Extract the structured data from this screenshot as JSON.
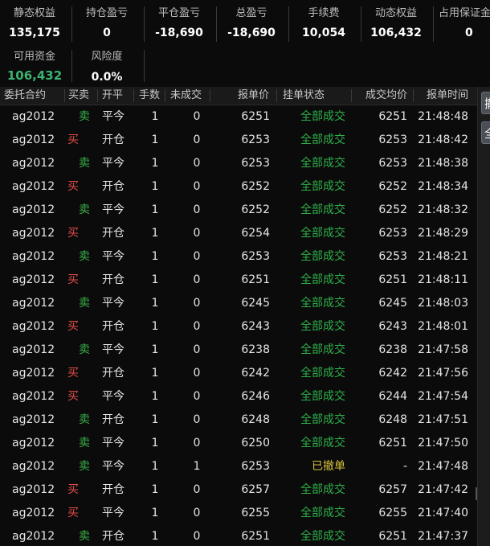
{
  "summary": {
    "static_equity": {
      "label": "静态权益",
      "value": "135,175"
    },
    "position_pnl": {
      "label": "持仓盈亏",
      "value": "0"
    },
    "close_pnl": {
      "label": "平仓盈亏",
      "value": "-18,690"
    },
    "total_pnl": {
      "label": "总盈亏",
      "value": "-18,690"
    },
    "fee": {
      "label": "手续费",
      "value": "10,054"
    },
    "dynamic_equity": {
      "label": "动态权益",
      "value": "106,432"
    },
    "margin_used": {
      "label": "占用保证金",
      "value": "0"
    },
    "available": {
      "label": "可用资金",
      "value": "106,432"
    },
    "risk": {
      "label": "风险度",
      "value": "0.0%"
    }
  },
  "table": {
    "headers": {
      "contract": "委托合约",
      "side": "买卖",
      "openclose": "开平",
      "qty": "手数",
      "unfilled": "未成交",
      "price": "报单价",
      "status": "挂单状态",
      "avg": "成交均价",
      "time": "报单时间"
    },
    "rows": [
      {
        "contract": "ag2012",
        "side": "卖",
        "openclose": "平今",
        "qty": "1",
        "unfilled": "0",
        "price": "6251",
        "status": "全部成交",
        "avg": "6251",
        "time": "21:48:48"
      },
      {
        "contract": "ag2012",
        "side": "买",
        "openclose": "开仓",
        "qty": "1",
        "unfilled": "0",
        "price": "6253",
        "status": "全部成交",
        "avg": "6253",
        "time": "21:48:42"
      },
      {
        "contract": "ag2012",
        "side": "卖",
        "openclose": "平今",
        "qty": "1",
        "unfilled": "0",
        "price": "6253",
        "status": "全部成交",
        "avg": "6253",
        "time": "21:48:38"
      },
      {
        "contract": "ag2012",
        "side": "买",
        "openclose": "开仓",
        "qty": "1",
        "unfilled": "0",
        "price": "6252",
        "status": "全部成交",
        "avg": "6252",
        "time": "21:48:34"
      },
      {
        "contract": "ag2012",
        "side": "卖",
        "openclose": "平今",
        "qty": "1",
        "unfilled": "0",
        "price": "6252",
        "status": "全部成交",
        "avg": "6252",
        "time": "21:48:32"
      },
      {
        "contract": "ag2012",
        "side": "买",
        "openclose": "开仓",
        "qty": "1",
        "unfilled": "0",
        "price": "6254",
        "status": "全部成交",
        "avg": "6253",
        "time": "21:48:29"
      },
      {
        "contract": "ag2012",
        "side": "卖",
        "openclose": "平今",
        "qty": "1",
        "unfilled": "0",
        "price": "6253",
        "status": "全部成交",
        "avg": "6253",
        "time": "21:48:21"
      },
      {
        "contract": "ag2012",
        "side": "买",
        "openclose": "开仓",
        "qty": "1",
        "unfilled": "0",
        "price": "6251",
        "status": "全部成交",
        "avg": "6251",
        "time": "21:48:11"
      },
      {
        "contract": "ag2012",
        "side": "卖",
        "openclose": "平今",
        "qty": "1",
        "unfilled": "0",
        "price": "6245",
        "status": "全部成交",
        "avg": "6245",
        "time": "21:48:03"
      },
      {
        "contract": "ag2012",
        "side": "买",
        "openclose": "开仓",
        "qty": "1",
        "unfilled": "0",
        "price": "6243",
        "status": "全部成交",
        "avg": "6243",
        "time": "21:48:01"
      },
      {
        "contract": "ag2012",
        "side": "卖",
        "openclose": "平今",
        "qty": "1",
        "unfilled": "0",
        "price": "6238",
        "status": "全部成交",
        "avg": "6238",
        "time": "21:47:58"
      },
      {
        "contract": "ag2012",
        "side": "买",
        "openclose": "开仓",
        "qty": "1",
        "unfilled": "0",
        "price": "6242",
        "status": "全部成交",
        "avg": "6242",
        "time": "21:47:56"
      },
      {
        "contract": "ag2012",
        "side": "买",
        "openclose": "平今",
        "qty": "1",
        "unfilled": "0",
        "price": "6246",
        "status": "全部成交",
        "avg": "6244",
        "time": "21:47:54"
      },
      {
        "contract": "ag2012",
        "side": "卖",
        "openclose": "开仓",
        "qty": "1",
        "unfilled": "0",
        "price": "6248",
        "status": "全部成交",
        "avg": "6248",
        "time": "21:47:51"
      },
      {
        "contract": "ag2012",
        "side": "卖",
        "openclose": "平今",
        "qty": "1",
        "unfilled": "0",
        "price": "6250",
        "status": "全部成交",
        "avg": "6251",
        "time": "21:47:50"
      },
      {
        "contract": "ag2012",
        "side": "卖",
        "openclose": "平今",
        "qty": "1",
        "unfilled": "1",
        "price": "6253",
        "status": "已撤单",
        "avg": "-",
        "time": "21:47:48"
      },
      {
        "contract": "ag2012",
        "side": "买",
        "openclose": "开仓",
        "qty": "1",
        "unfilled": "0",
        "price": "6257",
        "status": "全部成交",
        "avg": "6257",
        "time": "21:47:42"
      },
      {
        "contract": "ag2012",
        "side": "买",
        "openclose": "平今",
        "qty": "1",
        "unfilled": "0",
        "price": "6255",
        "status": "全部成交",
        "avg": "6255",
        "time": "21:47:40"
      },
      {
        "contract": "ag2012",
        "side": "卖",
        "openclose": "开仓",
        "qty": "1",
        "unfilled": "0",
        "price": "6251",
        "status": "全部成交",
        "avg": "6251",
        "time": "21:47:37"
      }
    ]
  },
  "right_panel": {
    "btn1": "撤",
    "btn2": "全"
  },
  "colors": {
    "buy": "#e14b4b",
    "sell": "#38b24a",
    "filled": "#2fb04a",
    "cancelled": "#d6c13a",
    "available": "#3cb371"
  }
}
